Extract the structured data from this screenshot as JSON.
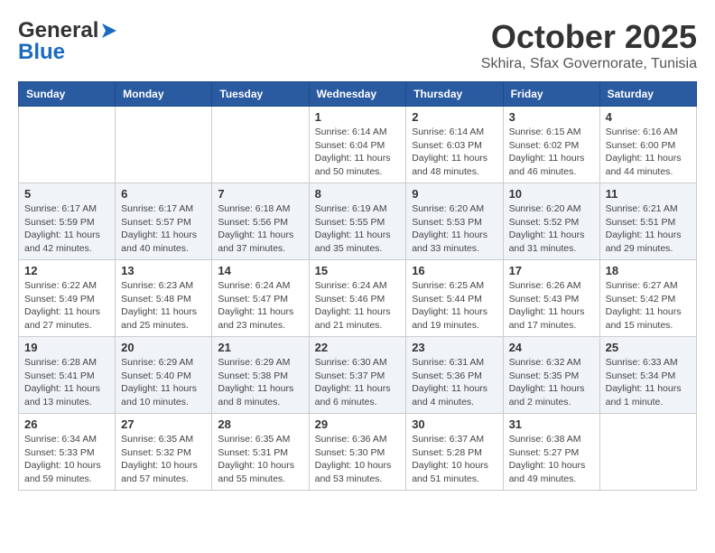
{
  "logo": {
    "general": "General",
    "blue": "Blue"
  },
  "header": {
    "month": "October 2025",
    "location": "Skhira, Sfax Governorate, Tunisia"
  },
  "days_of_week": [
    "Sunday",
    "Monday",
    "Tuesday",
    "Wednesday",
    "Thursday",
    "Friday",
    "Saturday"
  ],
  "weeks": [
    [
      {
        "day": "",
        "info": ""
      },
      {
        "day": "",
        "info": ""
      },
      {
        "day": "",
        "info": ""
      },
      {
        "day": "1",
        "info": "Sunrise: 6:14 AM\nSunset: 6:04 PM\nDaylight: 11 hours and 50 minutes."
      },
      {
        "day": "2",
        "info": "Sunrise: 6:14 AM\nSunset: 6:03 PM\nDaylight: 11 hours and 48 minutes."
      },
      {
        "day": "3",
        "info": "Sunrise: 6:15 AM\nSunset: 6:02 PM\nDaylight: 11 hours and 46 minutes."
      },
      {
        "day": "4",
        "info": "Sunrise: 6:16 AM\nSunset: 6:00 PM\nDaylight: 11 hours and 44 minutes."
      }
    ],
    [
      {
        "day": "5",
        "info": "Sunrise: 6:17 AM\nSunset: 5:59 PM\nDaylight: 11 hours and 42 minutes."
      },
      {
        "day": "6",
        "info": "Sunrise: 6:17 AM\nSunset: 5:57 PM\nDaylight: 11 hours and 40 minutes."
      },
      {
        "day": "7",
        "info": "Sunrise: 6:18 AM\nSunset: 5:56 PM\nDaylight: 11 hours and 37 minutes."
      },
      {
        "day": "8",
        "info": "Sunrise: 6:19 AM\nSunset: 5:55 PM\nDaylight: 11 hours and 35 minutes."
      },
      {
        "day": "9",
        "info": "Sunrise: 6:20 AM\nSunset: 5:53 PM\nDaylight: 11 hours and 33 minutes."
      },
      {
        "day": "10",
        "info": "Sunrise: 6:20 AM\nSunset: 5:52 PM\nDaylight: 11 hours and 31 minutes."
      },
      {
        "day": "11",
        "info": "Sunrise: 6:21 AM\nSunset: 5:51 PM\nDaylight: 11 hours and 29 minutes."
      }
    ],
    [
      {
        "day": "12",
        "info": "Sunrise: 6:22 AM\nSunset: 5:49 PM\nDaylight: 11 hours and 27 minutes."
      },
      {
        "day": "13",
        "info": "Sunrise: 6:23 AM\nSunset: 5:48 PM\nDaylight: 11 hours and 25 minutes."
      },
      {
        "day": "14",
        "info": "Sunrise: 6:24 AM\nSunset: 5:47 PM\nDaylight: 11 hours and 23 minutes."
      },
      {
        "day": "15",
        "info": "Sunrise: 6:24 AM\nSunset: 5:46 PM\nDaylight: 11 hours and 21 minutes."
      },
      {
        "day": "16",
        "info": "Sunrise: 6:25 AM\nSunset: 5:44 PM\nDaylight: 11 hours and 19 minutes."
      },
      {
        "day": "17",
        "info": "Sunrise: 6:26 AM\nSunset: 5:43 PM\nDaylight: 11 hours and 17 minutes."
      },
      {
        "day": "18",
        "info": "Sunrise: 6:27 AM\nSunset: 5:42 PM\nDaylight: 11 hours and 15 minutes."
      }
    ],
    [
      {
        "day": "19",
        "info": "Sunrise: 6:28 AM\nSunset: 5:41 PM\nDaylight: 11 hours and 13 minutes."
      },
      {
        "day": "20",
        "info": "Sunrise: 6:29 AM\nSunset: 5:40 PM\nDaylight: 11 hours and 10 minutes."
      },
      {
        "day": "21",
        "info": "Sunrise: 6:29 AM\nSunset: 5:38 PM\nDaylight: 11 hours and 8 minutes."
      },
      {
        "day": "22",
        "info": "Sunrise: 6:30 AM\nSunset: 5:37 PM\nDaylight: 11 hours and 6 minutes."
      },
      {
        "day": "23",
        "info": "Sunrise: 6:31 AM\nSunset: 5:36 PM\nDaylight: 11 hours and 4 minutes."
      },
      {
        "day": "24",
        "info": "Sunrise: 6:32 AM\nSunset: 5:35 PM\nDaylight: 11 hours and 2 minutes."
      },
      {
        "day": "25",
        "info": "Sunrise: 6:33 AM\nSunset: 5:34 PM\nDaylight: 11 hours and 1 minute."
      }
    ],
    [
      {
        "day": "26",
        "info": "Sunrise: 6:34 AM\nSunset: 5:33 PM\nDaylight: 10 hours and 59 minutes."
      },
      {
        "day": "27",
        "info": "Sunrise: 6:35 AM\nSunset: 5:32 PM\nDaylight: 10 hours and 57 minutes."
      },
      {
        "day": "28",
        "info": "Sunrise: 6:35 AM\nSunset: 5:31 PM\nDaylight: 10 hours and 55 minutes."
      },
      {
        "day": "29",
        "info": "Sunrise: 6:36 AM\nSunset: 5:30 PM\nDaylight: 10 hours and 53 minutes."
      },
      {
        "day": "30",
        "info": "Sunrise: 6:37 AM\nSunset: 5:28 PM\nDaylight: 10 hours and 51 minutes."
      },
      {
        "day": "31",
        "info": "Sunrise: 6:38 AM\nSunset: 5:27 PM\nDaylight: 10 hours and 49 minutes."
      },
      {
        "day": "",
        "info": ""
      }
    ]
  ]
}
